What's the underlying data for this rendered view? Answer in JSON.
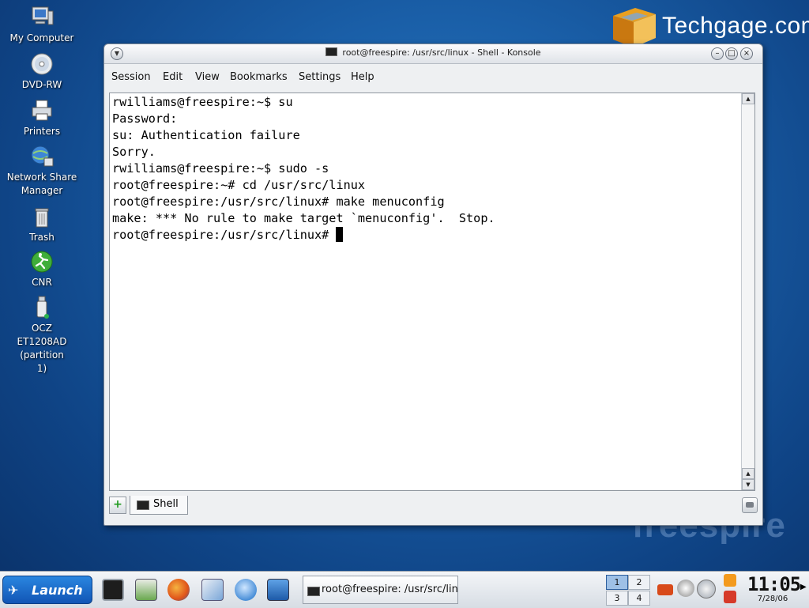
{
  "desktop": {
    "icons": [
      {
        "label": "My Computer",
        "icon": "computer-icon"
      },
      {
        "label": "DVD-RW",
        "icon": "disc-icon"
      },
      {
        "label": "Printers",
        "icon": "printer-icon"
      },
      {
        "label": "Network Share Manager",
        "icon": "network-share-icon"
      },
      {
        "label": "Trash",
        "icon": "trash-icon"
      },
      {
        "label": "CNR",
        "icon": "cnr-icon"
      },
      {
        "label": "OCZ ET1208AD (partition 1)",
        "icon": "usb-drive-icon"
      }
    ],
    "watermark": "Techgage.com",
    "background_brand": "freespire"
  },
  "window": {
    "title": "root@freespire: /usr/src/linux - Shell - Konsole",
    "menu": [
      "Session",
      "Edit",
      "View",
      "Bookmarks",
      "Settings",
      "Help"
    ],
    "terminal_lines": [
      "rwilliams@freespire:~$ su",
      "Password:",
      "su: Authentication failure",
      "Sorry.",
      "rwilliams@freespire:~$ sudo -s",
      "root@freespire:~# cd /usr/src/linux",
      "root@freespire:/usr/src/linux# make menuconfig",
      "make: *** No rule to make target `menuconfig'.  Stop."
    ],
    "prompt": "root@freespire:/usr/src/linux# ",
    "tab_label": "Shell"
  },
  "taskbar": {
    "launch_label": "Launch",
    "quick_launch": [
      "terminal-icon",
      "file-manager-icon",
      "firefox-icon",
      "editor-icon",
      "messenger-icon",
      "desktop-icon"
    ],
    "task_label": "root@freespire: /usr/src/linux - Shell - Konsole",
    "pager": [
      "1",
      "2",
      "3",
      "4"
    ],
    "active_desktop": "1",
    "clock_time": "11:05",
    "clock_date": "7/28/06"
  },
  "colors": {
    "desktop_bg": "#1a5fa8",
    "launch_bg": "#1a6fd0",
    "terminal_bg": "#ffffff",
    "terminal_fg": "#000000"
  }
}
